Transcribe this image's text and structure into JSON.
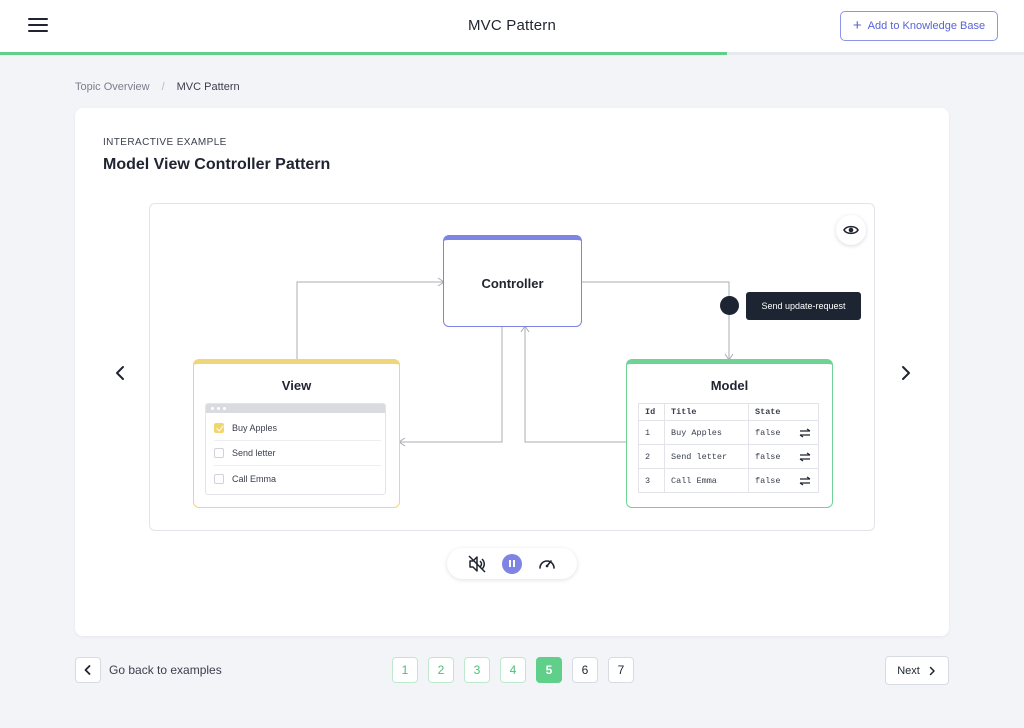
{
  "header": {
    "title": "MVC Pattern",
    "add_button_label": "Add to Knowledge Base",
    "progress_percent": 71,
    "progress_color": "#5fcf8a"
  },
  "breadcrumb": {
    "items": [
      "Topic Overview",
      "MVC Pattern"
    ],
    "separator": "/"
  },
  "card": {
    "eyebrow": "INTERACTIVE EXAMPLE",
    "title": "Model View Controller Pattern"
  },
  "diagram": {
    "controller": {
      "title": "Controller",
      "color": "#7d84e4"
    },
    "view": {
      "title": "View",
      "color": "#efd67a",
      "todos": [
        {
          "label": "Buy Apples",
          "checked": true
        },
        {
          "label": "Send letter",
          "checked": false
        },
        {
          "label": "Call Emma",
          "checked": false
        }
      ]
    },
    "model": {
      "title": "Model",
      "color": "#6fd396",
      "columns": [
        "Id",
        "Title",
        "State"
      ],
      "rows": [
        {
          "id": "1",
          "title": "Buy Apples",
          "state": "false"
        },
        {
          "id": "2",
          "title": "Send letter",
          "state": "false"
        },
        {
          "id": "3",
          "title": "Call Emma",
          "state": "false"
        }
      ]
    },
    "tooltip": "Send update-request"
  },
  "controls": {
    "icons": [
      "mute-icon",
      "pause-icon",
      "speed-icon"
    ]
  },
  "footer": {
    "back_label": "Go back to examples",
    "pages": [
      "1",
      "2",
      "3",
      "4",
      "5",
      "6",
      "7"
    ],
    "current_page": 5,
    "next_label": "Next"
  }
}
